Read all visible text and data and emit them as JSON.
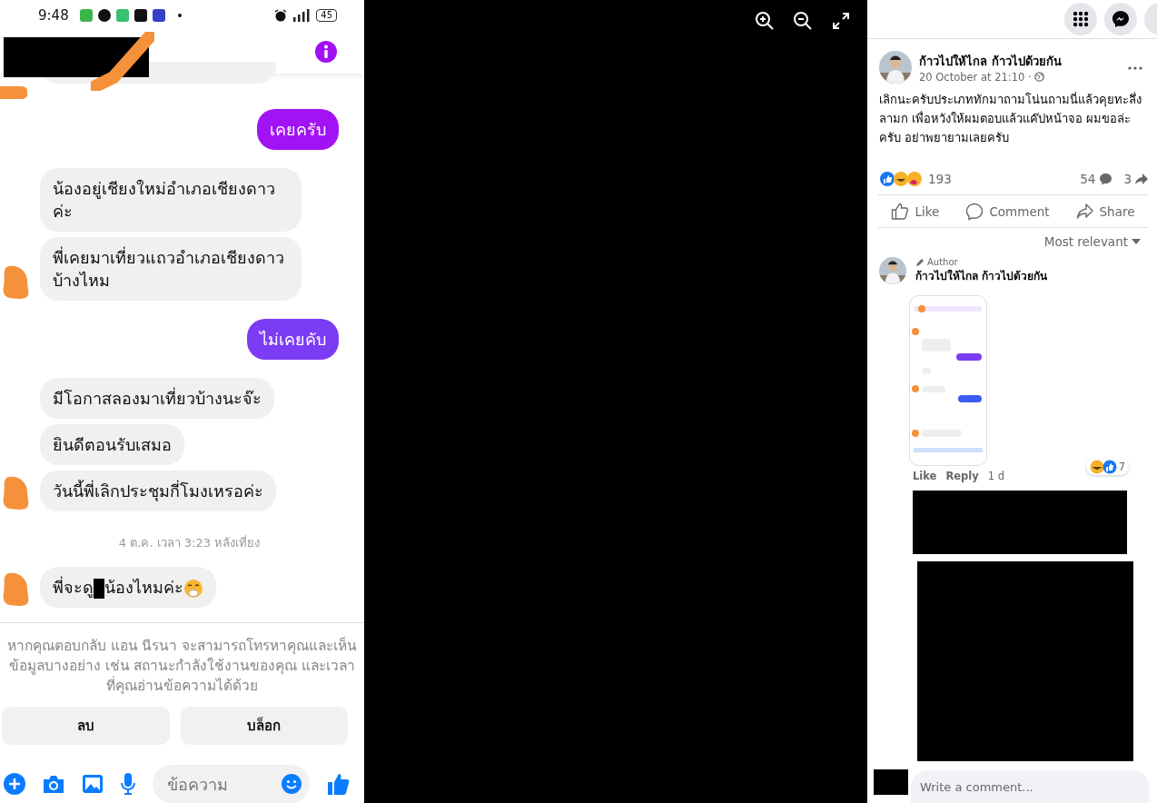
{
  "phone_screenshot": {
    "status_bar": {
      "time": "9:48",
      "battery": "45"
    },
    "messages": [
      {
        "kind": "partial"
      },
      {
        "kind": "sent",
        "text": "เคยครับ",
        "color": "#a112f5"
      },
      {
        "kind": "received",
        "text": "น้องอยู่เชียงใหม่อำเภอเชียงดาวค่ะ",
        "avatar": false
      },
      {
        "kind": "received",
        "text": "พี่เคยมาเที่ยวแถวอำเภอเชียงดาวบ้างไหม",
        "avatar": true
      },
      {
        "kind": "sent",
        "text": "ไม่เคยคับ",
        "color": "#7b3cf4"
      },
      {
        "kind": "received",
        "text": "มีโอกาสลองมาเที่ยวบ้างนะจ๊ะ",
        "avatar": false
      },
      {
        "kind": "received",
        "text": "ยินดีตอนรับเสมอ",
        "avatar": false
      },
      {
        "kind": "received",
        "text": "วันนี้พี่เลิกประชุมกี่โมงเหรอค่ะ",
        "avatar": true
      },
      {
        "kind": "timestamp",
        "text": "4 ต.ค. เวลา 3:23 หลังเที่ยง"
      },
      {
        "kind": "received",
        "text": "พี่จะดู",
        "text_after": "น้องไหมค่ะ",
        "redacted": true,
        "emoji": true,
        "avatar": true
      }
    ],
    "notice": "หากคุณตอบกลับ แอน นีรนา จะสามารถโทรหาคุณและเห็นข้อมูลบางอย่าง เช่น สถานะกำลังใช้งานของคุณ และเวลาที่คุณอ่านข้อความได้ด้วย",
    "actions": [
      "ลบ",
      "บล็อก"
    ],
    "composer": {
      "placeholder": "ข้อความ"
    }
  },
  "post": {
    "author": "ก้าวไปให้ไกล ก้าวไปด้วยกัน",
    "time": "20 October at 21:10 ·",
    "text": "เลิกนะครับประเภททักมาถามโน่นถามนี่แล้วคุยทะลึ่งลามก เพื่อหวังให้ผมตอบแล้วแค๊ปหน้าจอ ผมขอล่ะครับ อย่าพยายามเลยครับ",
    "reactions": "193",
    "comments": "54",
    "shares": "3",
    "actions": [
      "Like",
      "Comment",
      "Share"
    ],
    "sort": "Most relevant",
    "comment": {
      "badge": "Author",
      "author": "ก้าวไปให้ไกล ก้าวไปด้วยกัน",
      "actions": [
        "Like",
        "Reply"
      ],
      "age": "1 d",
      "reactions": "7"
    },
    "composer": {
      "placeholder": "Write a comment..."
    }
  }
}
